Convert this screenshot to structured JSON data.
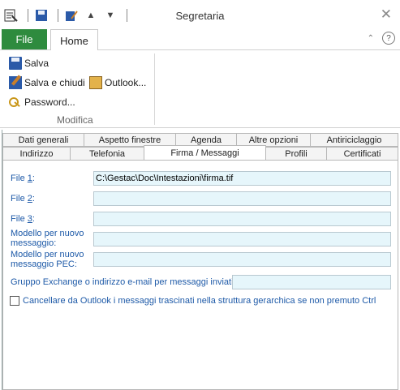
{
  "window": {
    "title": "Segretaria"
  },
  "ribbon": {
    "file_tab": "File",
    "home_tab": "Home",
    "buttons": {
      "save": "Salva",
      "save_close": "Salva e chiudi",
      "outlook": "Outlook...",
      "password": "Password..."
    },
    "group_label": "Modifica"
  },
  "tabs": {
    "row1": [
      "Dati generali",
      "Aspetto finestre",
      "Agenda",
      "Altre opzioni",
      "Antiriciclaggio"
    ],
    "row2": [
      "Indirizzo",
      "Telefonia",
      "Firma / Messaggi",
      "Profili",
      "Certificati"
    ],
    "active": "Firma / Messaggi"
  },
  "form": {
    "file1": {
      "label_pre": "File ",
      "label_key": "1",
      "label_post": ":",
      "value": "C:\\Gestac\\Doc\\Intestazioni\\firma.tif"
    },
    "file2": {
      "label_pre": "File ",
      "label_key": "2",
      "label_post": ":",
      "value": ""
    },
    "file3": {
      "label_pre": "File ",
      "label_key": "3",
      "label_post": ":",
      "value": ""
    },
    "modello_nuovo": {
      "label_line1": "Modello per nuovo",
      "label_line2": "messaggio:",
      "value": ""
    },
    "modello_pec": {
      "label_line1": "Modello per nuovo",
      "label_line2": "messaggio PEC:",
      "value": ""
    },
    "gruppo_exchange": {
      "label": "Gruppo Exchange o indirizzo e-mail per messaggi inviati:",
      "value": ""
    },
    "checkbox_cancellare": {
      "label": "Cancellare da Outlook i messaggi trascinati nella struttura gerarchica se non premuto Ctrl",
      "checked": false
    }
  }
}
